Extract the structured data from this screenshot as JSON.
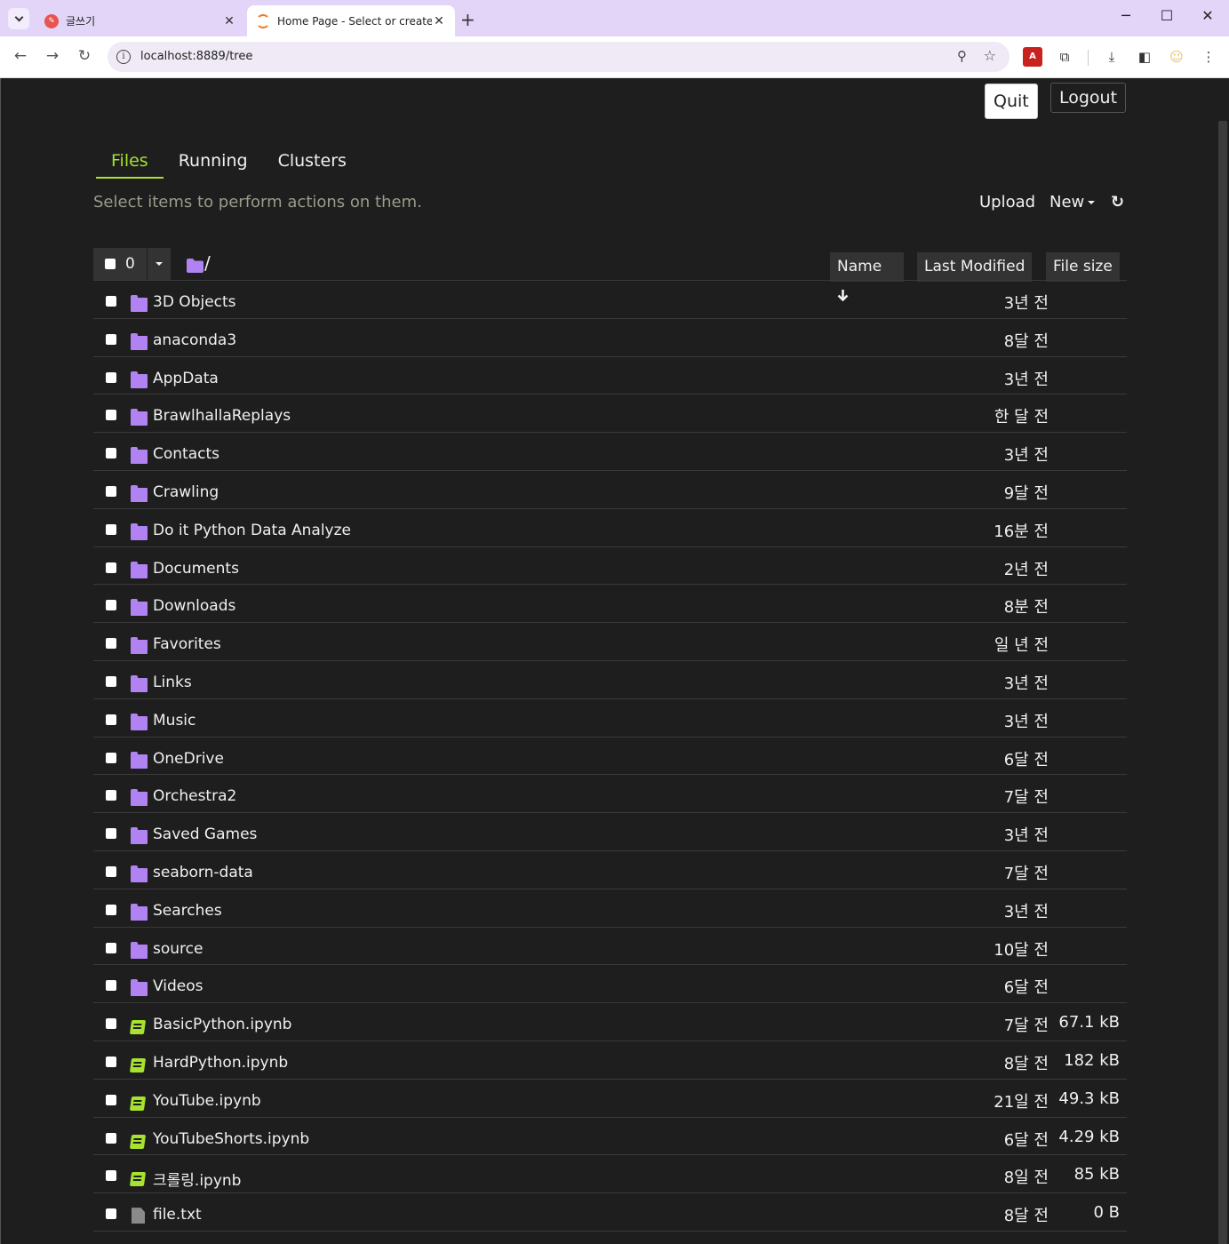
{
  "browser": {
    "tabs": [
      {
        "title": "글쓰기",
        "active": false,
        "close": "✕"
      },
      {
        "title": "Home Page - Select or create",
        "active": true,
        "close": "✕"
      }
    ],
    "new_tab": "+",
    "url": "localhost:8889/tree",
    "window_controls": {
      "minimize": "─",
      "maximize": "☐",
      "close": "✕"
    }
  },
  "header": {
    "quit_label": "Quit",
    "logout_label": "Logout"
  },
  "tabs": [
    {
      "label": "Files",
      "active": true
    },
    {
      "label": "Running",
      "active": false
    },
    {
      "label": "Clusters",
      "active": false
    }
  ],
  "toolbar": {
    "hint": "Select items to perform actions on them.",
    "upload_label": "Upload",
    "new_label": "New",
    "refresh_icon": "↻"
  },
  "selection": {
    "count": "0"
  },
  "breadcrumb": {
    "path": "/"
  },
  "columns": {
    "name": "Name",
    "name_sort_icon": "arrow-down-icon",
    "last_modified": "Last Modified",
    "file_size": "File size"
  },
  "colors": {
    "folder": "#b182f2",
    "notebook": "#a6e22e",
    "active_tab": "#a6e22e",
    "background": "#1e1e1e"
  },
  "files": [
    {
      "name": "3D Objects",
      "type": "folder",
      "modified": "3년 전",
      "size": ""
    },
    {
      "name": "anaconda3",
      "type": "folder",
      "modified": "8달 전",
      "size": ""
    },
    {
      "name": "AppData",
      "type": "folder",
      "modified": "3년 전",
      "size": ""
    },
    {
      "name": "BrawlhallaReplays",
      "type": "folder",
      "modified": "한 달 전",
      "size": ""
    },
    {
      "name": "Contacts",
      "type": "folder",
      "modified": "3년 전",
      "size": ""
    },
    {
      "name": "Crawling",
      "type": "folder",
      "modified": "9달 전",
      "size": ""
    },
    {
      "name": "Do it Python Data Analyze",
      "type": "folder",
      "modified": "16분 전",
      "size": ""
    },
    {
      "name": "Documents",
      "type": "folder",
      "modified": "2년 전",
      "size": ""
    },
    {
      "name": "Downloads",
      "type": "folder",
      "modified": "8분 전",
      "size": ""
    },
    {
      "name": "Favorites",
      "type": "folder",
      "modified": "일 년 전",
      "size": ""
    },
    {
      "name": "Links",
      "type": "folder",
      "modified": "3년 전",
      "size": ""
    },
    {
      "name": "Music",
      "type": "folder",
      "modified": "3년 전",
      "size": ""
    },
    {
      "name": "OneDrive",
      "type": "folder",
      "modified": "6달 전",
      "size": ""
    },
    {
      "name": "Orchestra2",
      "type": "folder",
      "modified": "7달 전",
      "size": ""
    },
    {
      "name": "Saved Games",
      "type": "folder",
      "modified": "3년 전",
      "size": ""
    },
    {
      "name": "seaborn-data",
      "type": "folder",
      "modified": "7달 전",
      "size": ""
    },
    {
      "name": "Searches",
      "type": "folder",
      "modified": "3년 전",
      "size": ""
    },
    {
      "name": "source",
      "type": "folder",
      "modified": "10달 전",
      "size": ""
    },
    {
      "name": "Videos",
      "type": "folder",
      "modified": "6달 전",
      "size": ""
    },
    {
      "name": "BasicPython.ipynb",
      "type": "notebook",
      "modified": "7달 전",
      "size": "67.1 kB"
    },
    {
      "name": "HardPython.ipynb",
      "type": "notebook",
      "modified": "8달 전",
      "size": "182 kB"
    },
    {
      "name": "YouTube.ipynb",
      "type": "notebook",
      "modified": "21일 전",
      "size": "49.3 kB"
    },
    {
      "name": "YouTubeShorts.ipynb",
      "type": "notebook",
      "modified": "6달 전",
      "size": "4.29 kB"
    },
    {
      "name": "크롤링.ipynb",
      "type": "notebook",
      "modified": "8일 전",
      "size": "85 kB"
    },
    {
      "name": "file.txt",
      "type": "file",
      "modified": "8달 전",
      "size": "0 B"
    }
  ]
}
